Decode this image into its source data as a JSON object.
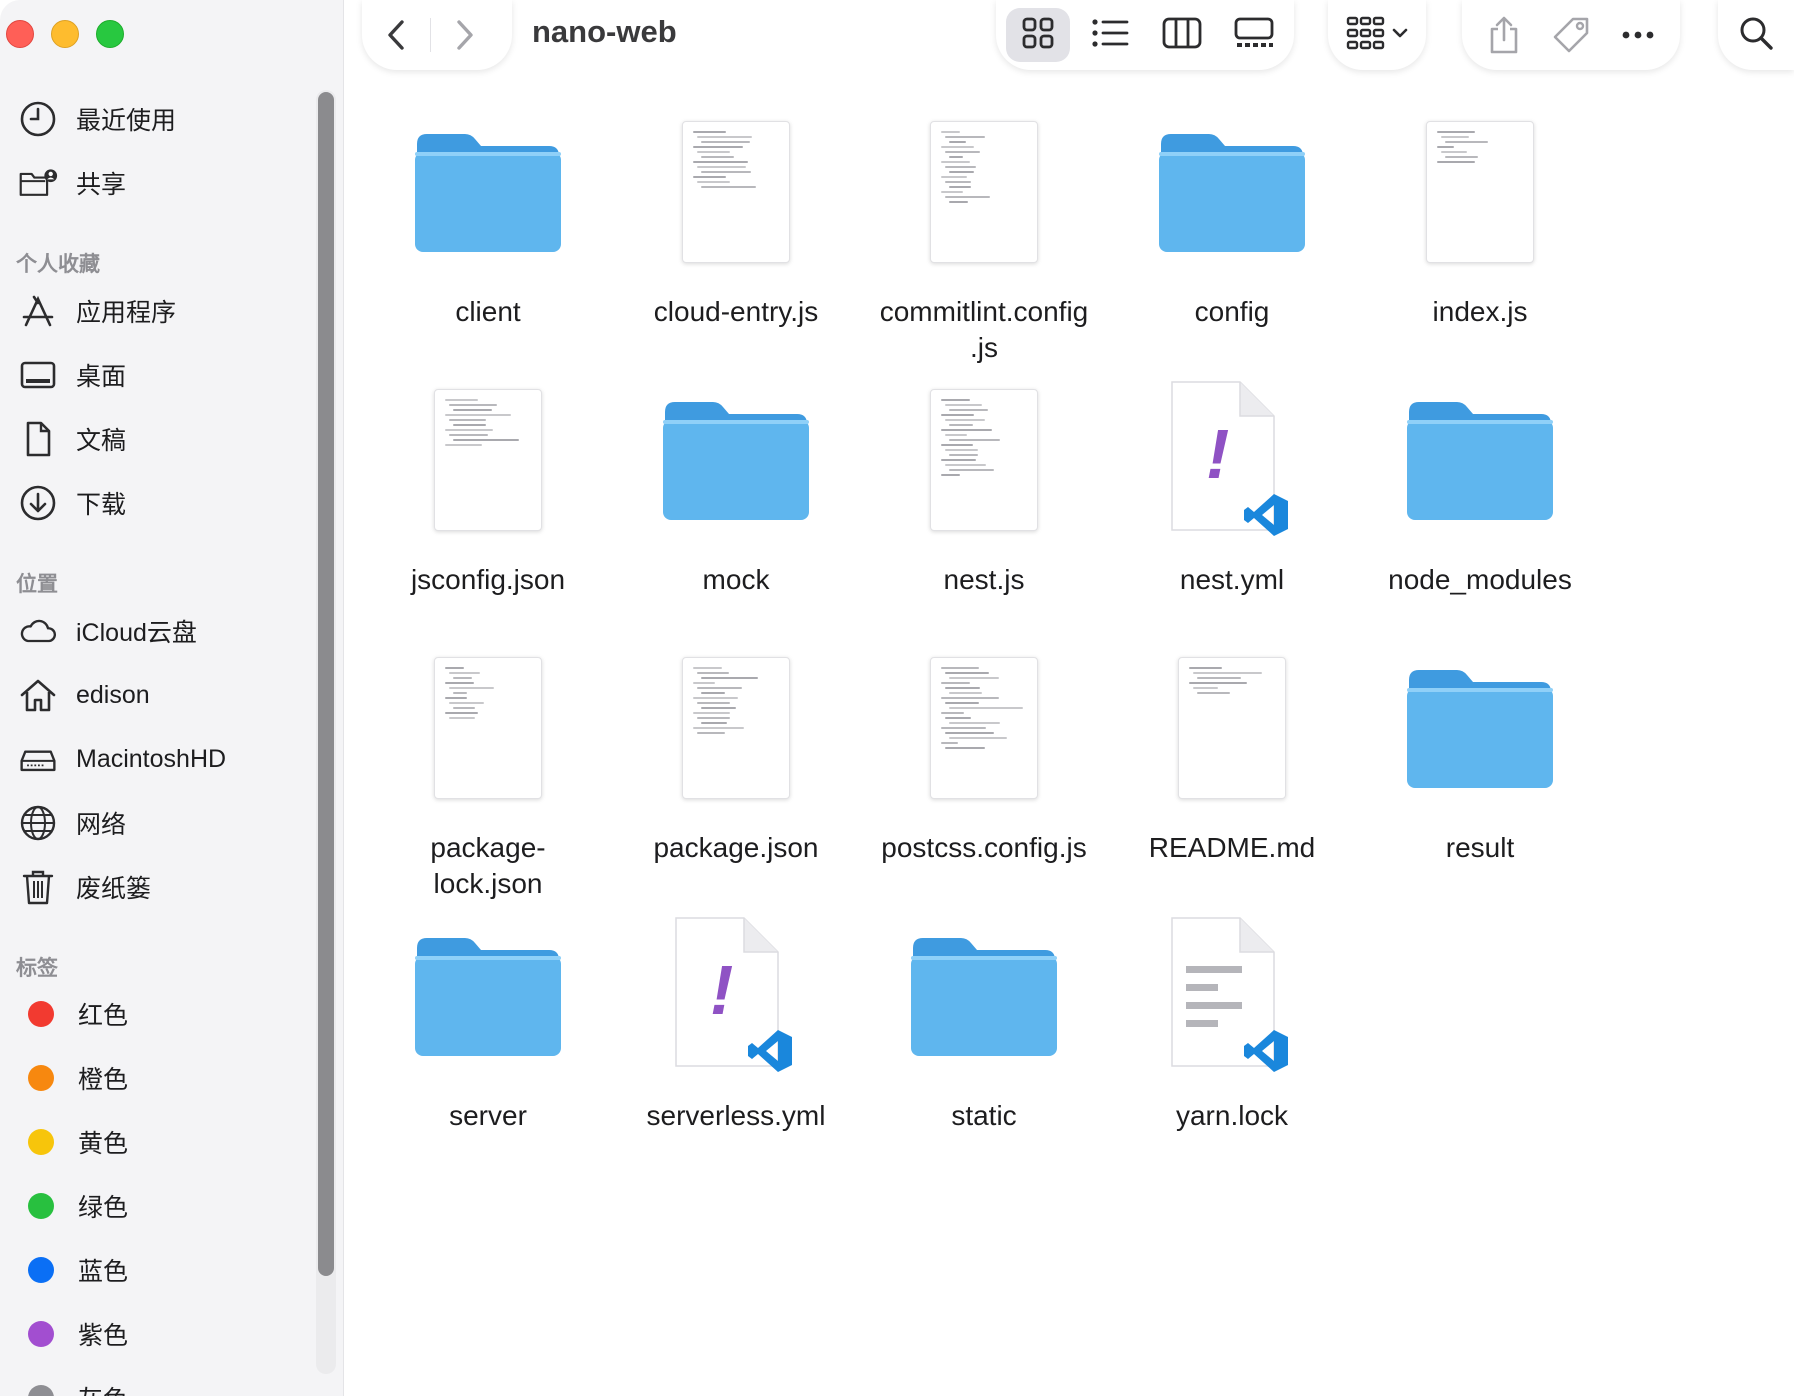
{
  "window": {
    "title": "nano-web"
  },
  "sidebar": {
    "top_items": [
      {
        "label": "最近使用",
        "icon": "clock-icon"
      },
      {
        "label": "共享",
        "icon": "shared-folder-icon"
      }
    ],
    "favorites_heading": "个人收藏",
    "favorites": [
      {
        "label": "应用程序",
        "icon": "applications-icon"
      },
      {
        "label": "桌面",
        "icon": "desktop-icon"
      },
      {
        "label": "文稿",
        "icon": "document-icon"
      },
      {
        "label": "下载",
        "icon": "download-icon"
      }
    ],
    "locations_heading": "位置",
    "locations": [
      {
        "label": "iCloud云盘",
        "icon": "cloud-icon"
      },
      {
        "label": "edison",
        "icon": "home-icon"
      },
      {
        "label": "MacintoshHD",
        "icon": "disk-icon"
      },
      {
        "label": "网络",
        "icon": "globe-icon"
      },
      {
        "label": "废纸篓",
        "icon": "trash-icon"
      }
    ],
    "tags_heading": "标签",
    "tags": [
      {
        "label": "红色",
        "color": "#f23a30"
      },
      {
        "label": "橙色",
        "color": "#f7880f"
      },
      {
        "label": "黄色",
        "color": "#f7c50b"
      },
      {
        "label": "绿色",
        "color": "#28c03f"
      },
      {
        "label": "蓝色",
        "color": "#0a6ff5"
      },
      {
        "label": "紫色",
        "color": "#a24ed0"
      },
      {
        "label": "灰色",
        "color": "#8e8e93"
      }
    ]
  },
  "toolbar": {
    "back_icon": "chevron-left-icon",
    "forward_icon": "chevron-right-icon",
    "view_modes": [
      "icon-view-icon",
      "list-view-icon",
      "column-view-icon",
      "gallery-view-icon"
    ],
    "active_view": "icon-view-icon",
    "group_icon": "group-grid-icon",
    "share_icon": "share-icon",
    "tag_icon": "tag-icon",
    "more_icon": "ellipsis-icon",
    "search_icon": "search-icon"
  },
  "files": [
    {
      "name": "client",
      "kind": "folder"
    },
    {
      "name": "cloud-entry.js",
      "kind": "doc"
    },
    {
      "name": "commitlint.config\n.js",
      "kind": "doc"
    },
    {
      "name": "config",
      "kind": "folder"
    },
    {
      "name": "index.js",
      "kind": "doc"
    },
    {
      "name": "jsconfig.json",
      "kind": "doc"
    },
    {
      "name": "mock",
      "kind": "folder"
    },
    {
      "name": "nest.js",
      "kind": "doc"
    },
    {
      "name": "nest.yml",
      "kind": "yml"
    },
    {
      "name": "node_modules",
      "kind": "folder"
    },
    {
      "name": "package-\nlock.json",
      "kind": "doc"
    },
    {
      "name": "package.json",
      "kind": "doc"
    },
    {
      "name": "postcss.config.js",
      "kind": "doc"
    },
    {
      "name": "README.md",
      "kind": "doc"
    },
    {
      "name": "result",
      "kind": "folder"
    },
    {
      "name": "server",
      "kind": "folder"
    },
    {
      "name": "serverless.yml",
      "kind": "yml"
    },
    {
      "name": "static",
      "kind": "folder"
    },
    {
      "name": "yarn.lock",
      "kind": "lock"
    }
  ],
  "colors": {
    "folder_front": "#5fb6ee",
    "folder_back": "#3f9be0",
    "vscode_blue": "#1a87dc",
    "yml_mark": "#8f52c4"
  }
}
